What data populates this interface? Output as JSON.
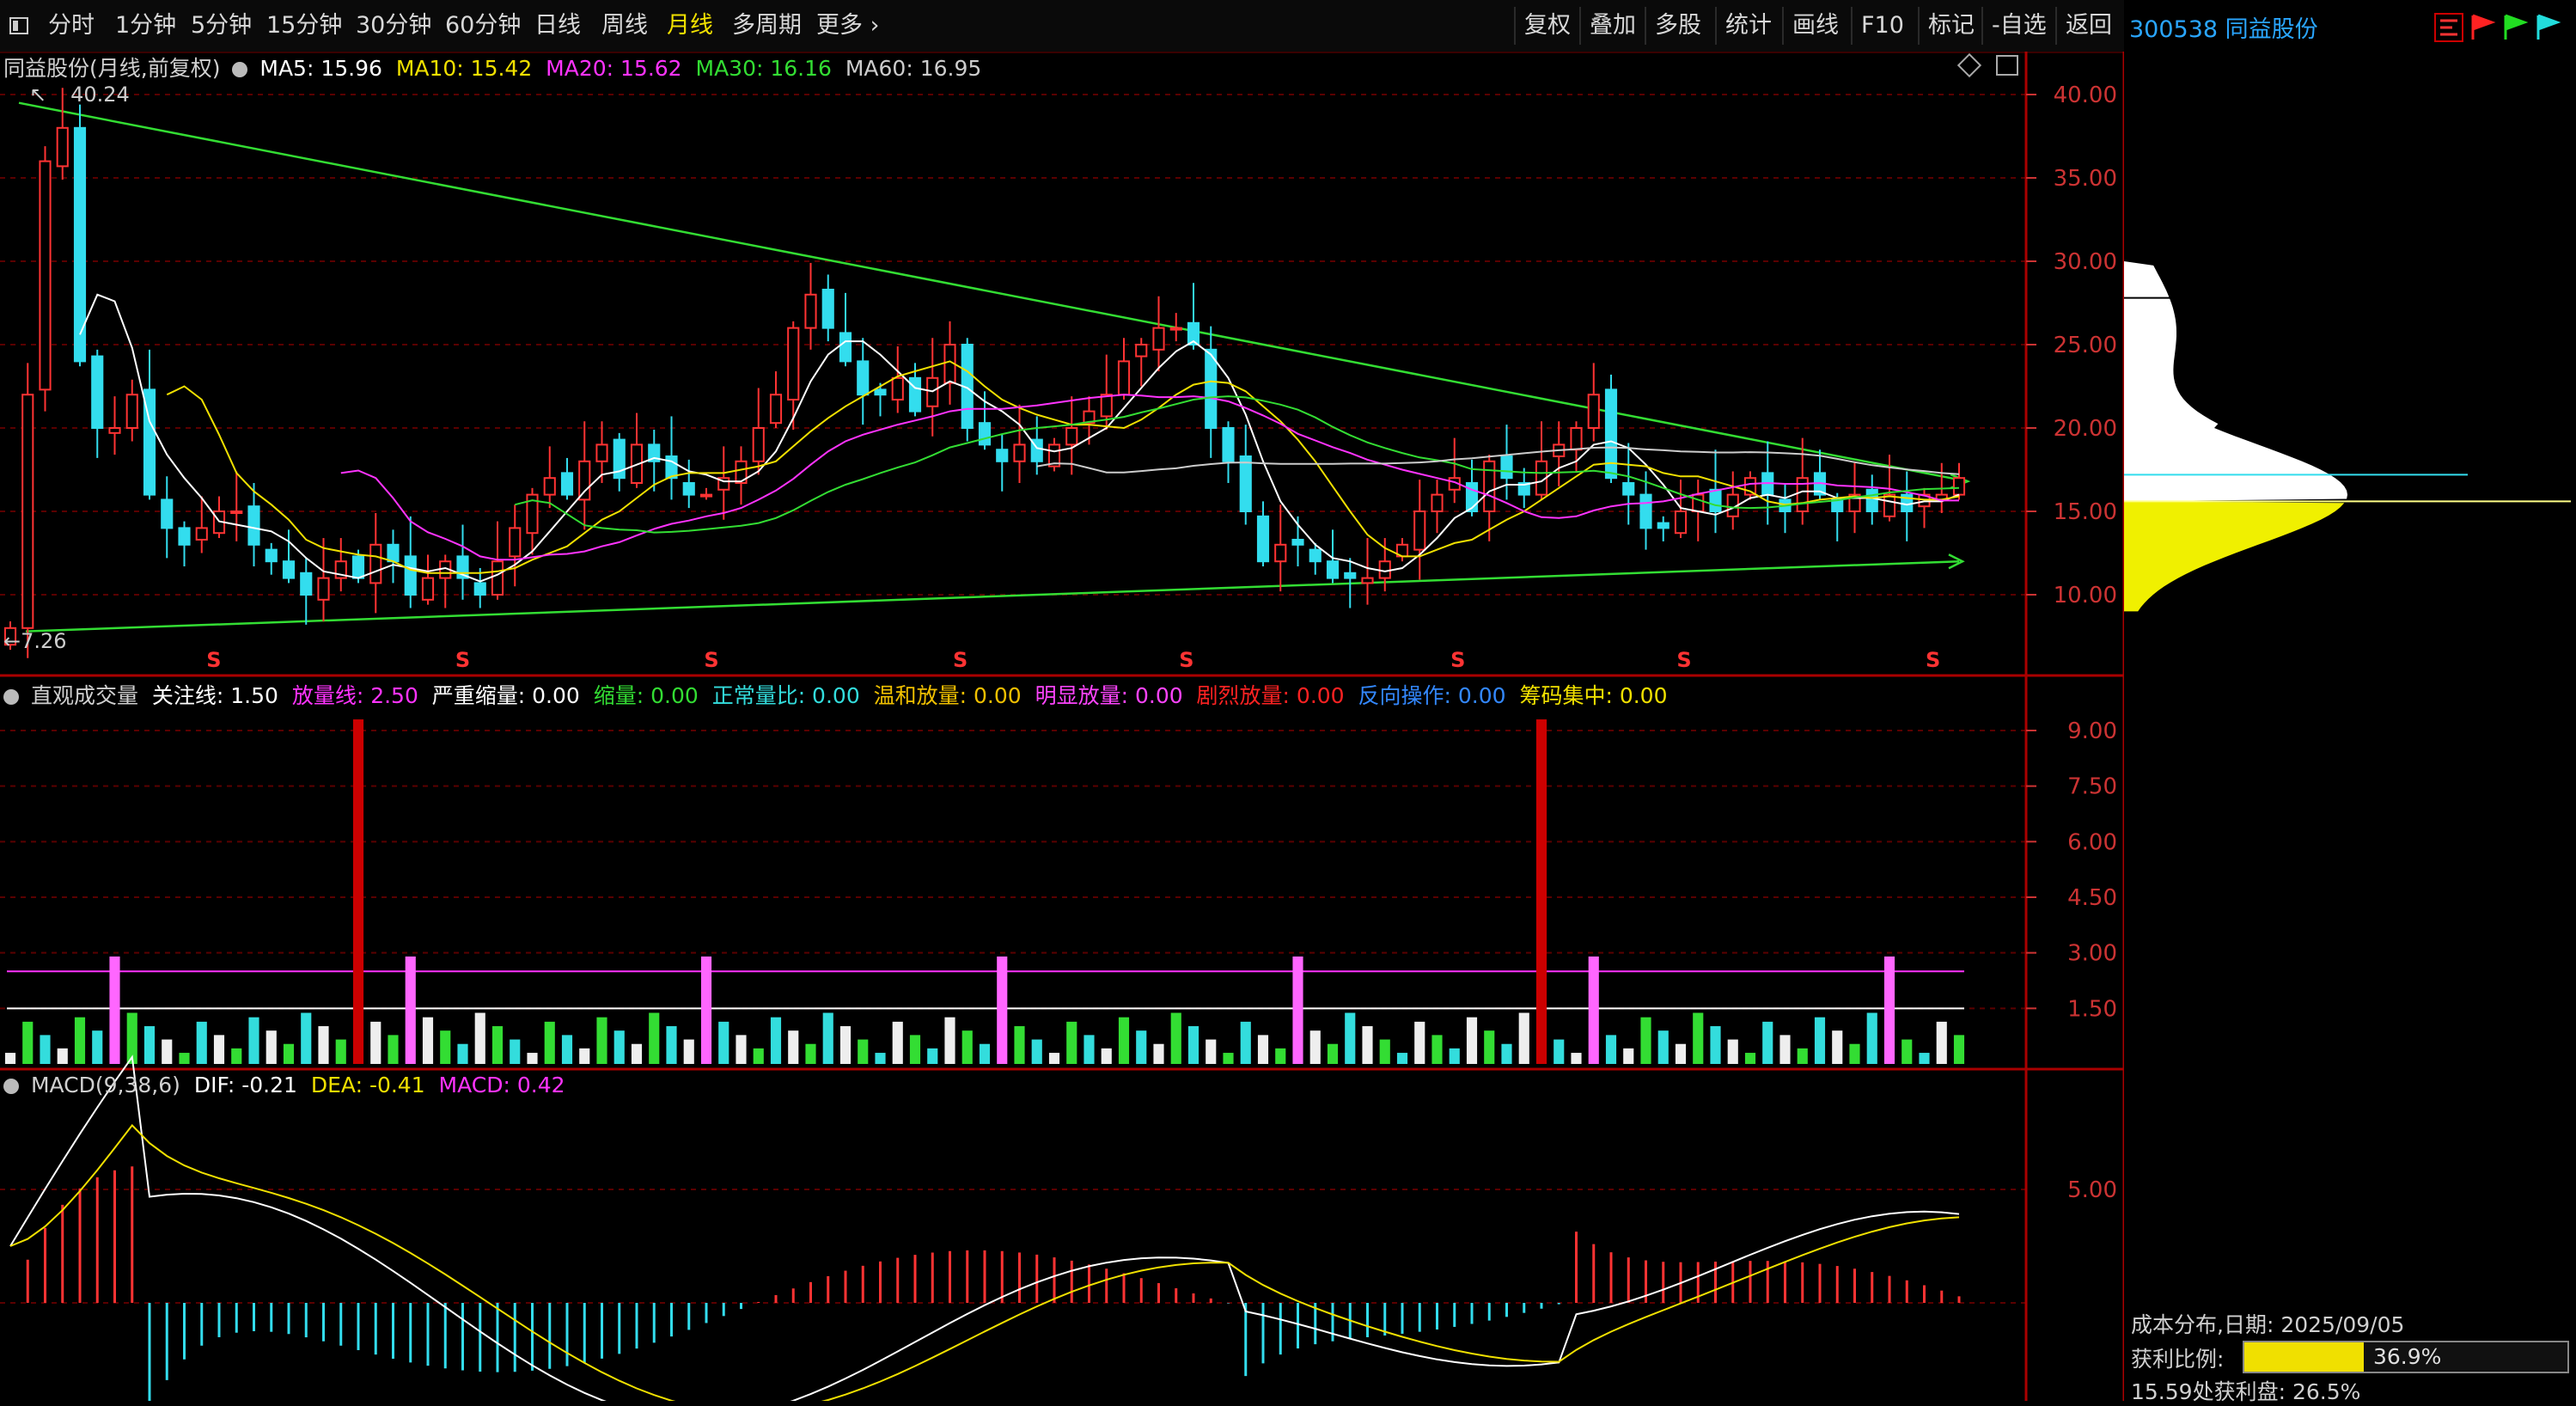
{
  "toolbar": {
    "menu_icon": "window-icon",
    "periods": [
      "分时",
      "1分钟",
      "5分钟",
      "15分钟",
      "30分钟",
      "60分钟",
      "日线",
      "周线",
      "月线",
      "多周期",
      "更多"
    ],
    "active_period": "月线",
    "more_chevron": "›",
    "right_buttons": [
      "复权",
      "叠加",
      "多股",
      "统计",
      "画线",
      "F10",
      "标记",
      "-自选",
      "返回"
    ]
  },
  "stock": {
    "code": "300538",
    "name": "同益股份"
  },
  "main_panel": {
    "title": "同益股份(月线,前复权)",
    "ma": [
      {
        "label": "MA5: 15.96",
        "color": "#ffffff"
      },
      {
        "label": "MA10: 15.42",
        "color": "#f0e000"
      },
      {
        "label": "MA20: 15.62",
        "color": "#ff33ff"
      },
      {
        "label": "MA30: 16.16",
        "color": "#33dd33"
      },
      {
        "label": "MA60: 16.95",
        "color": "#cccccc"
      }
    ],
    "high_label": "40.24",
    "low_label": "7.26",
    "y_ticks": [
      "40.00",
      "35.00",
      "30.00",
      "25.00",
      "20.00",
      "15.00",
      "10.00"
    ],
    "s_marker": "S"
  },
  "volume_panel": {
    "title": "直观成交量",
    "items": [
      {
        "label": "关注线: 1.50",
        "color": "#ffffff"
      },
      {
        "label": "放量线: 2.50",
        "color": "#ff33ff"
      },
      {
        "label": "严重缩量: 0.00",
        "color": "#ffffff"
      },
      {
        "label": "缩量: 0.00",
        "color": "#33dd33"
      },
      {
        "label": "正常量比: 0.00",
        "color": "#33dddd"
      },
      {
        "label": "温和放量: 0.00",
        "color": "#f0c000"
      },
      {
        "label": "明显放量: 0.00",
        "color": "#ff44ff"
      },
      {
        "label": "剧烈放量: 0.00",
        "color": "#ff2222"
      },
      {
        "label": "反向操作: 0.00",
        "color": "#3388ff"
      },
      {
        "label": "筹码集中: 0.00",
        "color": "#f0e000"
      }
    ],
    "y_ticks": [
      "9.00",
      "7.50",
      "6.00",
      "4.50",
      "3.00",
      "1.50"
    ]
  },
  "macd_panel": {
    "title": "MACD(9,38,6)",
    "items": [
      {
        "label": "DIF: -0.21",
        "color": "#ffffff"
      },
      {
        "label": "DEA: -0.41",
        "color": "#f0e000"
      },
      {
        "label": "MACD: 0.42",
        "color": "#ff33ff"
      }
    ],
    "y_ticks": [
      "5.00"
    ]
  },
  "cost": {
    "title": "成本分布,日期:",
    "date": "2025/09/05",
    "profit_ratio_label": "获利比例:",
    "profit_ratio_value": "36.9%",
    "profit_ratio": 0.369,
    "profit_at_label": "15.59处获利盘:",
    "profit_at_value": "26.5%"
  }
}
